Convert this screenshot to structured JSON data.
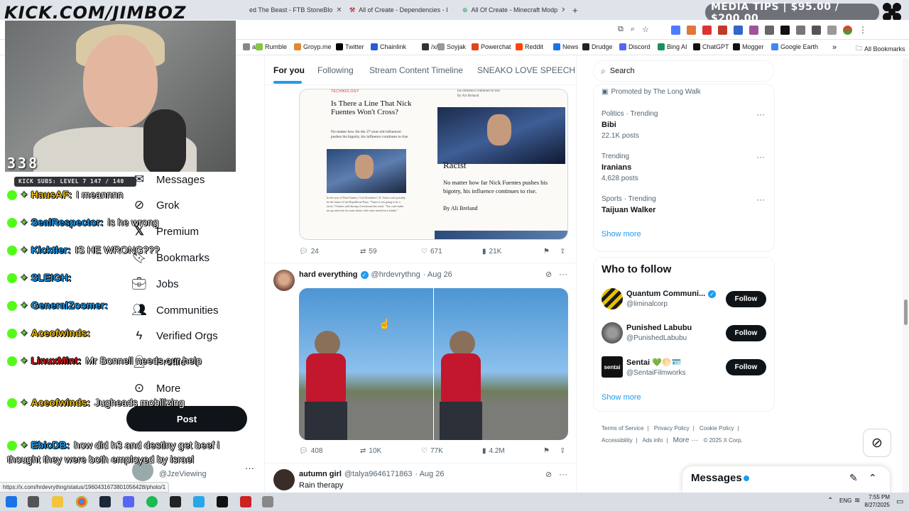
{
  "overlay": {
    "title": "KICK.COM/JIMBOZ",
    "viewers": "338",
    "kick_subs": "KICK SUBS: LEVEL 7 147 / 140",
    "media_tips": "MEDIA TIPS | $95.00 / $200.00"
  },
  "browser": {
    "tabs": [
      {
        "label": "ed The Beast - FTB StoneBlo"
      },
      {
        "label": "All of Create - Dependencies - I"
      },
      {
        "label": "All Of Create - Minecraft Modp"
      }
    ],
    "new_tab": "+",
    "bookmarks": [
      {
        "label": "at",
        "color": "#888"
      },
      {
        "label": "Rumble",
        "color": "#85c742"
      },
      {
        "label": "Groyp.me",
        "color": "#e08a2e"
      },
      {
        "label": "Twitter",
        "color": "#000"
      },
      {
        "label": "Chainlink",
        "color": "#2a5ada"
      },
      {
        "label": "/x/",
        "color": "#333"
      },
      {
        "label": "Soyjak",
        "color": "#999"
      },
      {
        "label": "Powerchat",
        "color": "#e0441c"
      },
      {
        "label": "Reddit",
        "color": "#ff4500"
      },
      {
        "label": "News",
        "color": "#1a73e8"
      },
      {
        "label": "Drudge",
        "color": "#222"
      },
      {
        "label": "Discord",
        "color": "#5865f2"
      },
      {
        "label": "Bing AI",
        "color": "#1b8f5a"
      },
      {
        "label": "ChatGPT",
        "color": "#111"
      },
      {
        "label": "Mogger",
        "color": "#111"
      },
      {
        "label": "Google Earth",
        "color": "#4285f4"
      }
    ],
    "all_bookmarks": "All Bookmarks",
    "status_url": "https://x.com/hrdevrythng/status/1960431673801056428/photo/1"
  },
  "nav": {
    "messages": "Messages",
    "grok": "Grok",
    "premium": "Premium",
    "bookmarks": "Bookmarks",
    "jobs": "Jobs",
    "communities": "Communities",
    "verified_orgs": "Verified Orgs",
    "profile": "Profile",
    "more": "More",
    "post": "Post",
    "account_handle": "@JzeViewing"
  },
  "chat": [
    {
      "user": "HausAF:",
      "color": "#f0c000",
      "msg": "I meannnn"
    },
    {
      "user": "SealRespector:",
      "color": "#1d9bf0",
      "msg": "is he wrong"
    },
    {
      "user": "Kicktler:",
      "color": "#1d9bf0",
      "msg": "IS HE WRONG???"
    },
    {
      "user": "SLEIGH:",
      "color": "#1d9bf0",
      "msg": ""
    },
    {
      "user": "GeneralZoomer:",
      "color": "#1d9bf0",
      "msg": ""
    },
    {
      "user": "Aceofwinds:",
      "color": "#f0c000",
      "msg": ""
    },
    {
      "user": "LinuxMint:",
      "color": "#d11",
      "msg": "Mr Bonnell needs our help"
    },
    {
      "user": "Aceofwinds:",
      "color": "#f0c000",
      "msg": "Jugheads mobilizing"
    },
    {
      "user": "EbicDB:",
      "color": "#1d9bf0",
      "msg": "how did h3 and destiny get beef i thought they were both employed by israel"
    }
  ],
  "feed": {
    "tabs": [
      "For you",
      "Following",
      "Stream Content Timeline",
      "SNEAKO LOVE SPEECH"
    ],
    "article": {
      "section": "TECHNOLOGY",
      "headline": "Is There a Line That Nick Fuentes Won't Cross?",
      "dek": "No matter how far the 27-year-old influencer pushes his bigotry, his influence continues to rise.",
      "right_top": "his influence continues to rise.",
      "right_byline_top": "By Ali Breland",
      "right_word": "Racist",
      "right_body": "No matter how far Nick Fuentes pushes his bigotry, his influence continues to rise.",
      "byline": "By Ali Breland",
      "body_excerpt": "In the eyes of Nick Fuentes, Vice President J. D. Vance can't possibly be the future of the Republican Party. \"Vance is not going to be a racist,\" Fuentes said during a livestream last week. \"You can't make me go and vote for some future with some mixed-race family.\""
    },
    "post1_actions": {
      "replies": "24",
      "reposts": "59",
      "likes": "671",
      "views": "21K"
    },
    "post2": {
      "name": "hard everything",
      "handle": "@hrdevrythng",
      "date": "· Aug 26",
      "actions": {
        "replies": "408",
        "reposts": "10K",
        "likes": "77K",
        "views": "4.2M"
      }
    },
    "post3": {
      "name": "autumn girl",
      "handle": "@talya9646171863",
      "date": "· Aug 26",
      "text": "Rain therapy"
    }
  },
  "right": {
    "search_placeholder": "Search",
    "promoted": "Promoted by The Long Walk",
    "trends": [
      {
        "category": "Politics · Trending",
        "name": "Bibi",
        "posts": "22.1K posts"
      },
      {
        "category": "Trending",
        "name": "Iranians",
        "posts": "4,628 posts"
      },
      {
        "category": "Sports · Trending",
        "name": "Taijuan Walker",
        "posts": ""
      }
    ],
    "show_more": "Show more",
    "who_to_follow": "Who to follow",
    "accounts": [
      {
        "name": "Quantum Communi...",
        "handle": "@liminalcorp",
        "follow": "Follow"
      },
      {
        "name": "Punished Labubu",
        "handle": "@PunishedLabubu",
        "follow": "Follow"
      },
      {
        "name": "Sentai 💚🌕🪪",
        "handle": "@SentaiFilmworks",
        "follow": "Follow"
      }
    ],
    "footer": [
      "Terms of Service",
      "Privacy Policy",
      "Cookie Policy",
      "Accessibility",
      "Ads info",
      "More ···",
      "© 2025 X Corp."
    ],
    "messages": "Messages"
  },
  "taskbar": {
    "lang": "ENG",
    "time": "7:55 PM",
    "date": "8/27/2025"
  }
}
